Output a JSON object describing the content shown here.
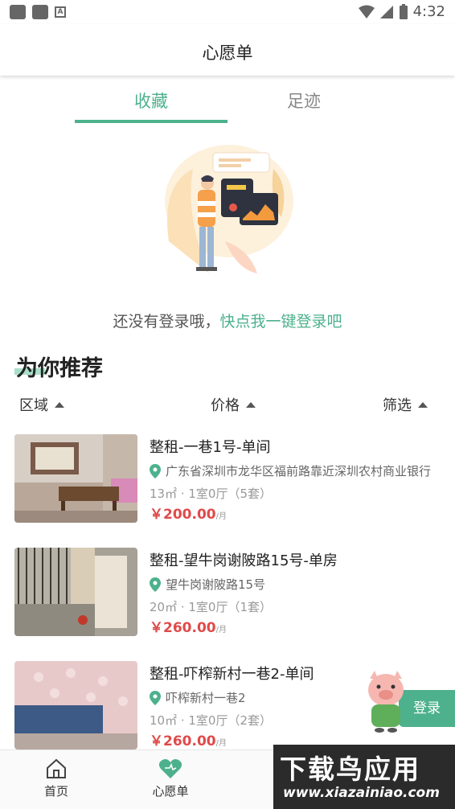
{
  "status_bar": {
    "time": "4:32"
  },
  "header": {
    "title": "心愿单"
  },
  "tabs": [
    {
      "label": "收藏",
      "active": true
    },
    {
      "label": "足迹",
      "active": false
    }
  ],
  "login_hint": {
    "text": "还没有登录哦，",
    "link": "快点我一键登录吧"
  },
  "recommend": {
    "title": "为你推荐",
    "filters": [
      "区域",
      "价格",
      "筛选"
    ]
  },
  "listings": [
    {
      "title": "整租-一巷1号-单间",
      "address": "广东省深圳市龙华区福前路靠近深圳农村商业银行",
      "spec": "13㎡ · 1室0厅（5套）",
      "price": "￥200.00",
      "unit": "/月"
    },
    {
      "title": "整租-望牛岗谢陂路15号-单房",
      "address": "望牛岗谢陂路15号",
      "spec": "20㎡ · 1室0厅（1套）",
      "price": "￥260.00",
      "unit": "/月"
    },
    {
      "title": "整租-吓榨新村一巷2-单间",
      "address": "吓榨新村一巷2",
      "spec": "10㎡ · 1室0厅（2套）",
      "price": "￥260.00",
      "unit": "/月"
    }
  ],
  "float_login": {
    "label": "登录"
  },
  "bottom_nav": [
    {
      "label": "首页"
    },
    {
      "label": "心愿单"
    }
  ],
  "watermark": {
    "top": "下载鸟应用",
    "bottom": "www.xiazainiao.com"
  },
  "colors": {
    "accent": "#4db18d",
    "price": "#e04a4a"
  }
}
